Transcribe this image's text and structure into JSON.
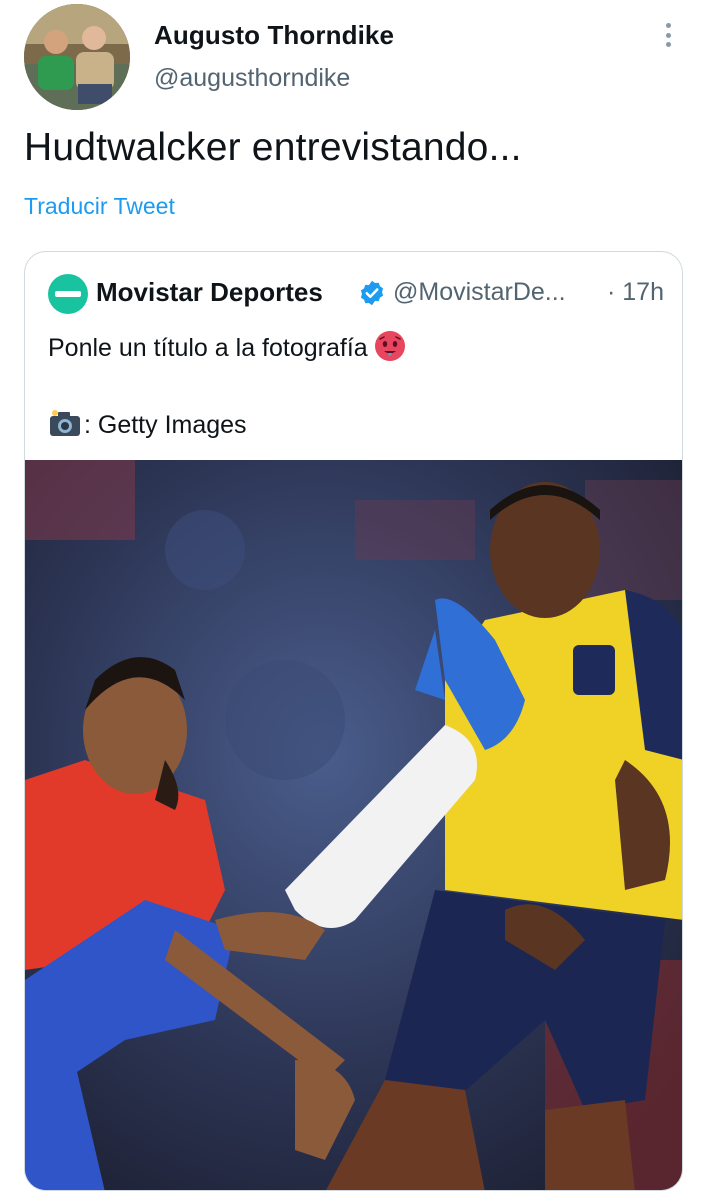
{
  "tweet": {
    "author_name": "Augusto Thorndike",
    "author_handle": "@augusthorndike",
    "text": "Hudtwalcker entrevistando...",
    "translate_label": "Traducir Tweet",
    "more_icon": "more-vertical-icon"
  },
  "quote": {
    "author_name": "Movistar Deportes",
    "author_handle": "@MovistarDe...",
    "time": "· 17h",
    "line1": "Ponle un título a la fotografía",
    "line1_emoji": "hot-face-emoji",
    "line2": ": Getty Images",
    "line2_emoji": "camera-flash-emoji",
    "verified_icon": "verified-badge-icon"
  },
  "colors": {
    "link": "#1d9bf0",
    "secondary_text": "#536471",
    "border": "#cfd9de",
    "brand_green": "#19c3a0"
  }
}
